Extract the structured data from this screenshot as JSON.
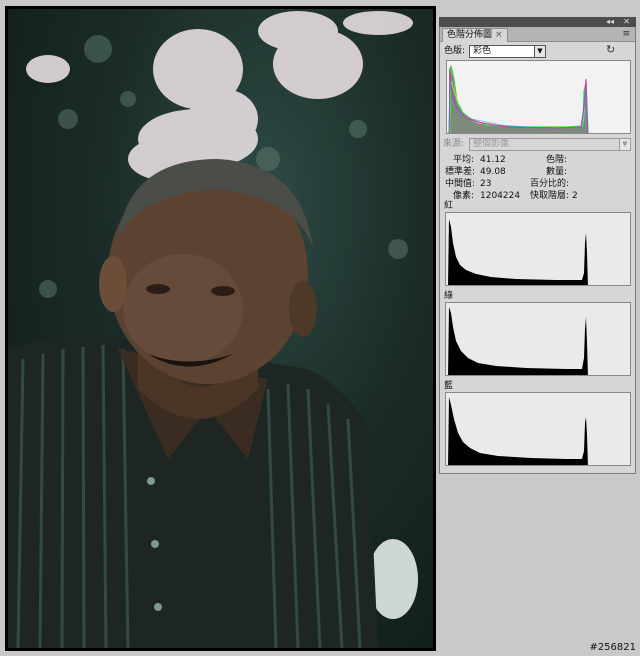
{
  "panel": {
    "tab_label": "色階分佈圖",
    "tab_close": "×",
    "collapse_glyph": "◂◂",
    "close_glyph": "✕",
    "menu_glyph": "≡",
    "channel_label": "色版:",
    "channel_value": "彩色",
    "refresh_glyph": "↻",
    "warning_glyph": "⚠",
    "source_label": "來源:",
    "source_value": "整個影像",
    "stats": {
      "mean_label": "平均:",
      "mean_value": "41.12",
      "std_label": "標準差:",
      "std_value": "49.08",
      "median_label": "中間值:",
      "median_value": "23",
      "pixels_label": "像素:",
      "pixels_value": "1204224",
      "level_label": "色階:",
      "count_label": "數量:",
      "percentile_label": "百分比的:",
      "cache_label": "快取階層:",
      "cache_value": "2"
    },
    "red_label": "紅",
    "green_label": "綠",
    "blue_label": "藍"
  },
  "watermark": "#256821",
  "icons": {
    "refresh": "refresh-icon",
    "warning": "cache-warning-icon",
    "menu": "panel-menu-icon",
    "dropdown": "chevron-down-icon"
  },
  "colors": {
    "panel_bg": "#d6d6d6",
    "photo_tint": "#1b2c28"
  }
}
